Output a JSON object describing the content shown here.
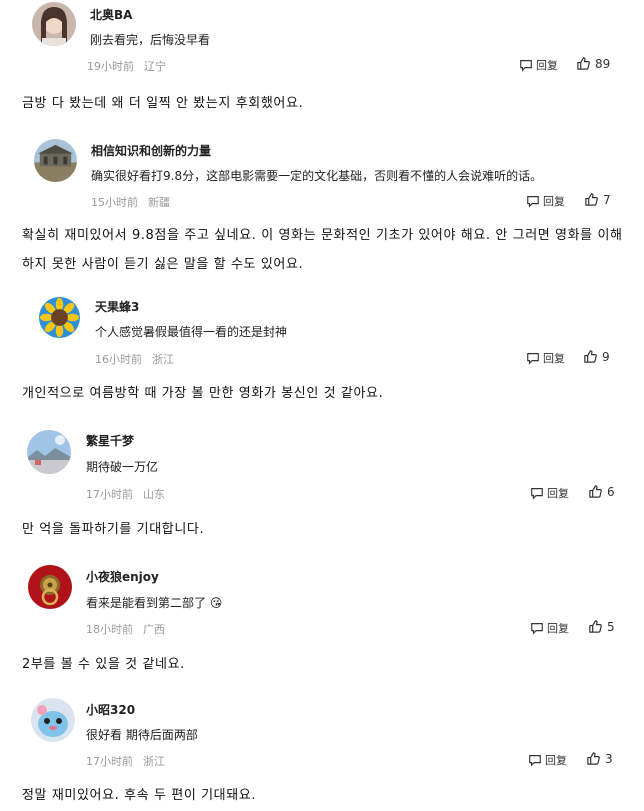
{
  "reply_label": "回复",
  "comments": [
    {
      "user": "北奥BA",
      "text": "刚去看完，后悔没早看",
      "time": "19小时前",
      "location": "辽宁",
      "likes": "89",
      "avatar_icon": "girl-portrait",
      "translation": "금방 다 봤는데 왜 더 일찍 안 봤는지 후회했어요."
    },
    {
      "user": "相信知识和创新的力量",
      "text": "确实很好看打9.8分，这部电影需要一定的文化基础，否则看不懂的人会说难听的话。",
      "time": "15小时前",
      "location": "新疆",
      "likes": "7",
      "avatar_icon": "building-photo",
      "translation": "확실히 재미있어서 9.8점을 주고 싶네요. 이 영화는 문화적인 기초가 있어야 해요. 안 그러면 영화를 이해하지 못한 사람이 듣기 싫은 말을 할 수도 있어요."
    },
    {
      "user": "天果蜂3",
      "text": "个人感觉暑假最值得一看的还是封神",
      "time": "16小时前",
      "location": "浙江",
      "likes": "9",
      "avatar_icon": "sunflower",
      "translation": "개인적으로 여름방학 때 가장 볼 만한 영화가 봉신인 것 같아요."
    },
    {
      "user": "繁星千梦",
      "text": "期待破一万亿",
      "time": "17小时前",
      "location": "山东",
      "likes": "6",
      "avatar_icon": "landscape-photo",
      "translation": "만 억을 돌파하기를 기대합니다."
    },
    {
      "user": "小夜狼enjoy",
      "text": "看来是能看到第二部了 😘",
      "time": "18小时前",
      "location": "广西",
      "likes": "5",
      "avatar_icon": "red-knocker",
      "translation": "2부를 볼 수 있을 것 같네요."
    },
    {
      "user": "小昭320",
      "text": "很好看 期待后面两部",
      "time": "17小时前",
      "location": "浙江",
      "likes": "3",
      "avatar_icon": "cartoon-character",
      "translation": "정말 재미있어요. 후속 두 편이 기대돼요."
    }
  ]
}
